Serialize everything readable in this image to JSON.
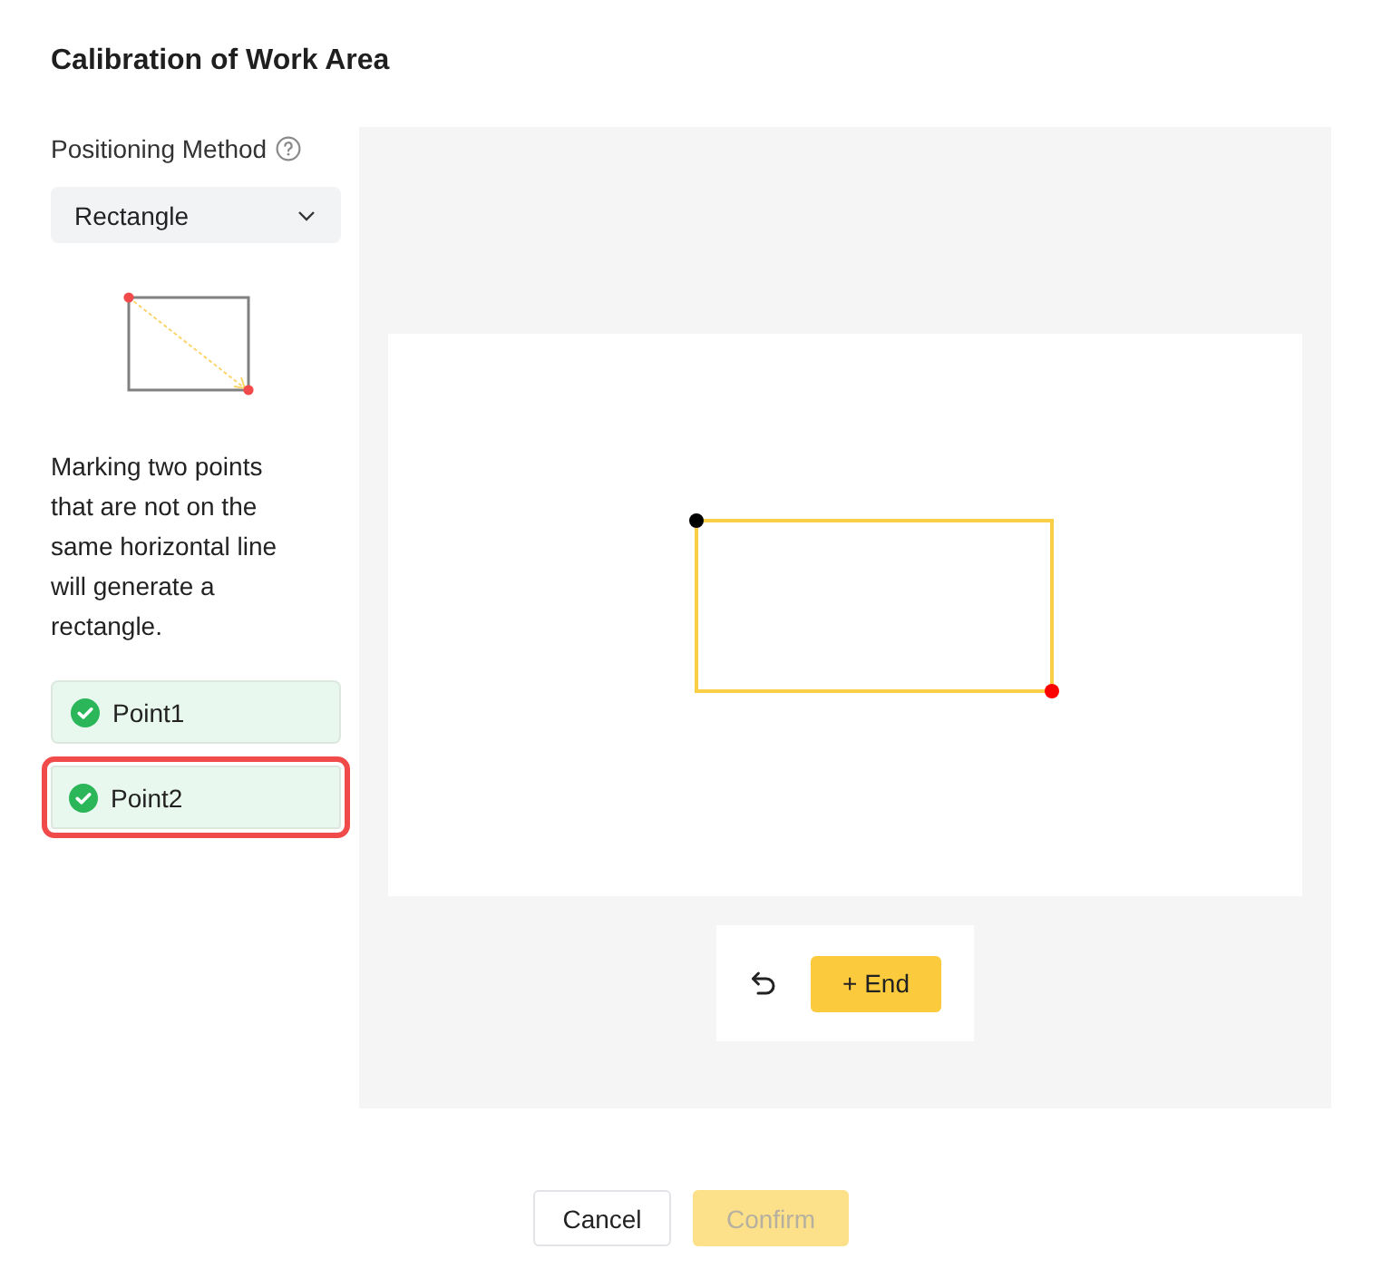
{
  "dialog": {
    "title": "Calibration of Work Area"
  },
  "positioning": {
    "label": "Positioning Method",
    "method": "Rectangle",
    "description": "Marking two points that are not on the same horizontal line will generate a rectangle."
  },
  "points": [
    {
      "label": "Point1",
      "marked": true,
      "selected": false
    },
    {
      "label": "Point2",
      "marked": true,
      "selected": true
    }
  ],
  "toolbar": {
    "end_label": "+ End"
  },
  "footer": {
    "buttons": [
      {
        "label": "Cancel",
        "kind": "secondary",
        "disabled": false
      },
      {
        "label": "Confirm",
        "kind": "primary",
        "disabled": true
      }
    ]
  }
}
